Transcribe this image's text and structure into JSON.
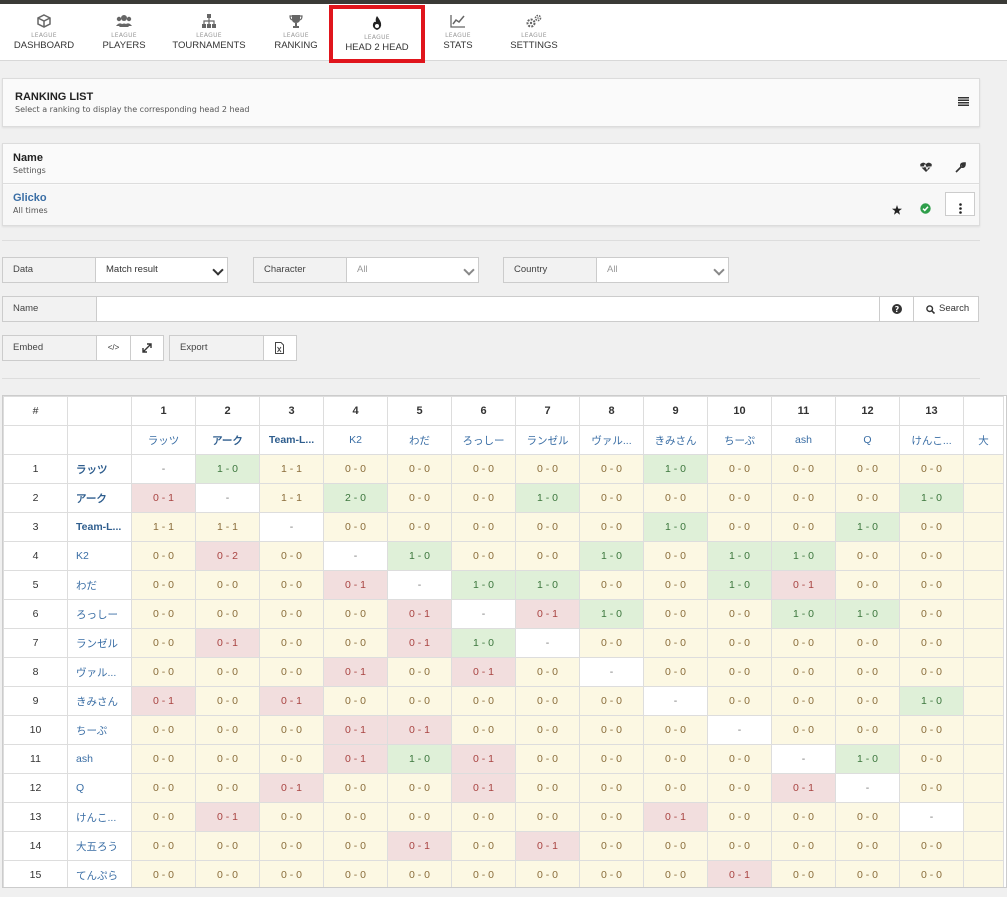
{
  "nav": {
    "items": [
      {
        "small": "LEAGUE",
        "label": "DASHBOARD",
        "icon": "cube-icon"
      },
      {
        "small": "LEAGUE",
        "label": "PLAYERS",
        "icon": "users-icon"
      },
      {
        "small": "LEAGUE",
        "label": "TOURNAMENTS",
        "icon": "bracket-icon"
      },
      {
        "small": "LEAGUE",
        "label": "RANKING",
        "icon": "trophy-icon"
      },
      {
        "small": "LEAGUE",
        "label": "HEAD 2 HEAD",
        "icon": "flame-icon"
      },
      {
        "small": "LEAGUE",
        "label": "STATS",
        "icon": "chart-line-icon"
      },
      {
        "small": "LEAGUE",
        "label": "SETTINGS",
        "icon": "gears-icon"
      }
    ]
  },
  "ranking_list": {
    "title": "RANKING LIST",
    "subtitle": "Select a ranking to display the corresponding head 2 head",
    "icon": "list-icon"
  },
  "ranking_table": {
    "header_name": "Name",
    "header_sub": "Settings",
    "row_name": "Glicko",
    "row_sub": "All times"
  },
  "filters": {
    "data_label": "Data",
    "data_value": "Match result",
    "character_label": "Character",
    "character_value": "All",
    "country_label": "Country",
    "country_value": "All",
    "name_label": "Name",
    "name_placeholder": "",
    "search_label": "Search",
    "embed_label": "Embed",
    "embed_code": "</>",
    "export_label": "Export"
  },
  "h2h": {
    "hash": "#",
    "columns": [
      "1",
      "2",
      "3",
      "4",
      "5",
      "6",
      "7",
      "8",
      "9",
      "10",
      "11",
      "12",
      "13"
    ],
    "col_names": [
      "ラッツ",
      "アーク",
      "Team-L...",
      "K2",
      "わだ",
      "ろっしー",
      "ランゼル",
      "ヴァル...",
      "きみさん",
      "ちーぷ",
      "ash",
      "Q",
      "けんこ..."
    ],
    "col_bold": [
      false,
      true,
      true,
      false,
      false,
      false,
      false,
      false,
      false,
      false,
      false,
      false,
      false
    ],
    "rows": [
      {
        "n": "1",
        "name": "ラッツ",
        "bold": true,
        "cells": [
          "-",
          "1 - 0",
          "1 - 1",
          "0 - 0",
          "0 - 0",
          "0 - 0",
          "0 - 0",
          "0 - 0",
          "1 - 0",
          "0 - 0",
          "0 - 0",
          "0 - 0",
          "0 - 0"
        ]
      },
      {
        "n": "2",
        "name": "アーク",
        "bold": true,
        "cells": [
          "0 - 1",
          "-",
          "1 - 1",
          "2 - 0",
          "0 - 0",
          "0 - 0",
          "1 - 0",
          "0 - 0",
          "0 - 0",
          "0 - 0",
          "0 - 0",
          "0 - 0",
          "1 - 0"
        ]
      },
      {
        "n": "3",
        "name": "Team-L...",
        "bold": true,
        "cells": [
          "1 - 1",
          "1 - 1",
          "-",
          "0 - 0",
          "0 - 0",
          "0 - 0",
          "0 - 0",
          "0 - 0",
          "1 - 0",
          "0 - 0",
          "0 - 0",
          "1 - 0",
          "0 - 0"
        ]
      },
      {
        "n": "4",
        "name": "K2",
        "bold": false,
        "cells": [
          "0 - 0",
          "0 - 2",
          "0 - 0",
          "-",
          "1 - 0",
          "0 - 0",
          "0 - 0",
          "1 - 0",
          "0 - 0",
          "1 - 0",
          "1 - 0",
          "0 - 0",
          "0 - 0"
        ]
      },
      {
        "n": "5",
        "name": "わだ",
        "bold": false,
        "cells": [
          "0 - 0",
          "0 - 0",
          "0 - 0",
          "0 - 1",
          "-",
          "1 - 0",
          "1 - 0",
          "0 - 0",
          "0 - 0",
          "1 - 0",
          "0 - 1",
          "0 - 0",
          "0 - 0"
        ]
      },
      {
        "n": "6",
        "name": "ろっしー",
        "bold": false,
        "cells": [
          "0 - 0",
          "0 - 0",
          "0 - 0",
          "0 - 0",
          "0 - 1",
          "-",
          "0 - 1",
          "1 - 0",
          "0 - 0",
          "0 - 0",
          "1 - 0",
          "1 - 0",
          "0 - 0"
        ]
      },
      {
        "n": "7",
        "name": "ランゼル",
        "bold": false,
        "cells": [
          "0 - 0",
          "0 - 1",
          "0 - 0",
          "0 - 0",
          "0 - 1",
          "1 - 0",
          "-",
          "0 - 0",
          "0 - 0",
          "0 - 0",
          "0 - 0",
          "0 - 0",
          "0 - 0"
        ]
      },
      {
        "n": "8",
        "name": "ヴァル...",
        "bold": false,
        "cells": [
          "0 - 0",
          "0 - 0",
          "0 - 0",
          "0 - 1",
          "0 - 0",
          "0 - 1",
          "0 - 0",
          "-",
          "0 - 0",
          "0 - 0",
          "0 - 0",
          "0 - 0",
          "0 - 0"
        ]
      },
      {
        "n": "9",
        "name": "きみさん",
        "bold": false,
        "cells": [
          "0 - 1",
          "0 - 0",
          "0 - 1",
          "0 - 0",
          "0 - 0",
          "0 - 0",
          "0 - 0",
          "0 - 0",
          "-",
          "0 - 0",
          "0 - 0",
          "0 - 0",
          "1 - 0"
        ]
      },
      {
        "n": "10",
        "name": "ちーぷ",
        "bold": false,
        "cells": [
          "0 - 0",
          "0 - 0",
          "0 - 0",
          "0 - 1",
          "0 - 1",
          "0 - 0",
          "0 - 0",
          "0 - 0",
          "0 - 0",
          "-",
          "0 - 0",
          "0 - 0",
          "0 - 0"
        ]
      },
      {
        "n": "11",
        "name": "ash",
        "bold": false,
        "cells": [
          "0 - 0",
          "0 - 0",
          "0 - 0",
          "0 - 1",
          "1 - 0",
          "0 - 1",
          "0 - 0",
          "0 - 0",
          "0 - 0",
          "0 - 0",
          "-",
          "1 - 0",
          "0 - 0"
        ]
      },
      {
        "n": "12",
        "name": "Q",
        "bold": false,
        "cells": [
          "0 - 0",
          "0 - 0",
          "0 - 1",
          "0 - 0",
          "0 - 0",
          "0 - 1",
          "0 - 0",
          "0 - 0",
          "0 - 0",
          "0 - 0",
          "0 - 1",
          "-",
          "0 - 0"
        ]
      },
      {
        "n": "13",
        "name": "けんこ...",
        "bold": false,
        "cells": [
          "0 - 0",
          "0 - 1",
          "0 - 0",
          "0 - 0",
          "0 - 0",
          "0 - 0",
          "0 - 0",
          "0 - 0",
          "0 - 1",
          "0 - 0",
          "0 - 0",
          "0 - 0",
          "-"
        ]
      },
      {
        "n": "14",
        "name": "大五ろう",
        "bold": false,
        "cells": [
          "0 - 0",
          "0 - 0",
          "0 - 0",
          "0 - 0",
          "0 - 1",
          "0 - 0",
          "0 - 1",
          "0 - 0",
          "0 - 0",
          "0 - 0",
          "0 - 0",
          "0 - 0",
          "0 - 0"
        ]
      },
      {
        "n": "15",
        "name": "てんぷら",
        "bold": false,
        "cells": [
          "0 - 0",
          "0 - 0",
          "0 - 0",
          "0 - 0",
          "0 - 0",
          "0 - 0",
          "0 - 0",
          "0 - 0",
          "0 - 0",
          "0 - 1",
          "0 - 0",
          "0 - 0",
          "0 - 0"
        ]
      }
    ],
    "partial_col_name": "大"
  },
  "colors": {
    "active_nav_border": "#e0151c",
    "win_bg": "#dff0d8",
    "loss_bg": "#f2dede",
    "neutral_bg": "#fcf8e3",
    "link": "#3a6ea5",
    "check_green": "#2e9e4a"
  }
}
